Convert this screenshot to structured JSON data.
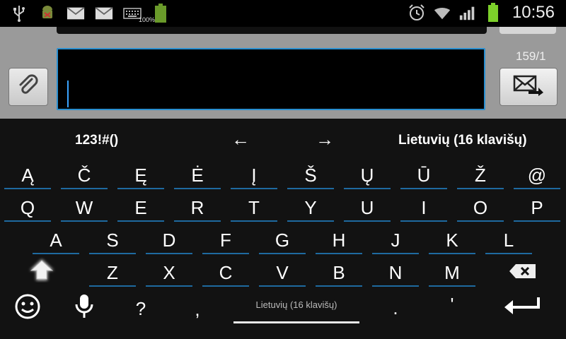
{
  "status_bar": {
    "icons_left": [
      "usb-icon",
      "android-debug-icon",
      "email-icon",
      "email-icon",
      "keyboard-icon",
      "battery-charging-icon"
    ],
    "battery_percent": "100%",
    "icons_right": [
      "alarm-icon",
      "wifi-icon",
      "signal-icon",
      "battery-icon"
    ],
    "time": "10:56"
  },
  "compose": {
    "char_counter": "159/1",
    "message_placeholder": ""
  },
  "keyboard": {
    "symbols_label": "123!#()",
    "left_arrow": "←",
    "right_arrow": "→",
    "language_label": "Lietuvių (16 klavišų)",
    "row1": [
      "Ą",
      "Č",
      "Ę",
      "Ė",
      "Į",
      "Š",
      "Ų",
      "Ū",
      "Ž",
      "@"
    ],
    "row2": [
      "Q",
      "W",
      "E",
      "R",
      "T",
      "Y",
      "U",
      "I",
      "O",
      "P"
    ],
    "row3": [
      "A",
      "S",
      "D",
      "F",
      "G",
      "H",
      "J",
      "K",
      "L"
    ],
    "row4": [
      "Z",
      "X",
      "C",
      "V",
      "B",
      "N",
      "M"
    ],
    "bottom": {
      "question": "?",
      "comma": ",",
      "space_label": "Lietuvių (16 klavišų)",
      "period": ".",
      "apostrophe": "'"
    }
  }
}
